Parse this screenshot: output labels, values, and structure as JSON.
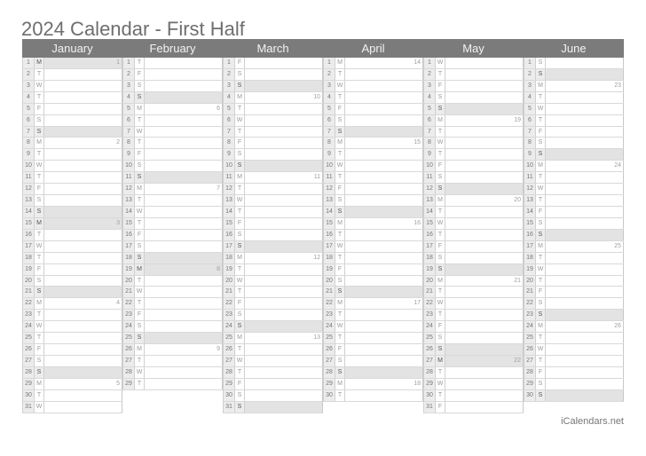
{
  "title": "2024 Calendar - First Half",
  "footer": "iCalendars.net",
  "colors": {
    "header_bg": "#7b7b7b",
    "shade": "#e3e3e3",
    "text": "#6e6e6e"
  },
  "months": [
    {
      "name": "January",
      "first_weekday": 1,
      "days": 31,
      "week_start": 1,
      "holidays": [
        1,
        15
      ]
    },
    {
      "name": "February",
      "first_weekday": 4,
      "days": 29,
      "week_start": 6,
      "holidays": [
        19
      ]
    },
    {
      "name": "March",
      "first_weekday": 5,
      "days": 31,
      "week_start": 10,
      "holidays": []
    },
    {
      "name": "April",
      "first_weekday": 1,
      "days": 30,
      "week_start": 14,
      "holidays": []
    },
    {
      "name": "May",
      "first_weekday": 3,
      "days": 31,
      "week_start": 19,
      "holidays": [
        27
      ]
    },
    {
      "name": "June",
      "first_weekday": 6,
      "days": 30,
      "week_start": 23,
      "holidays": []
    }
  ],
  "weekday_letters": [
    "S",
    "M",
    "T",
    "W",
    "T",
    "F",
    "S"
  ]
}
